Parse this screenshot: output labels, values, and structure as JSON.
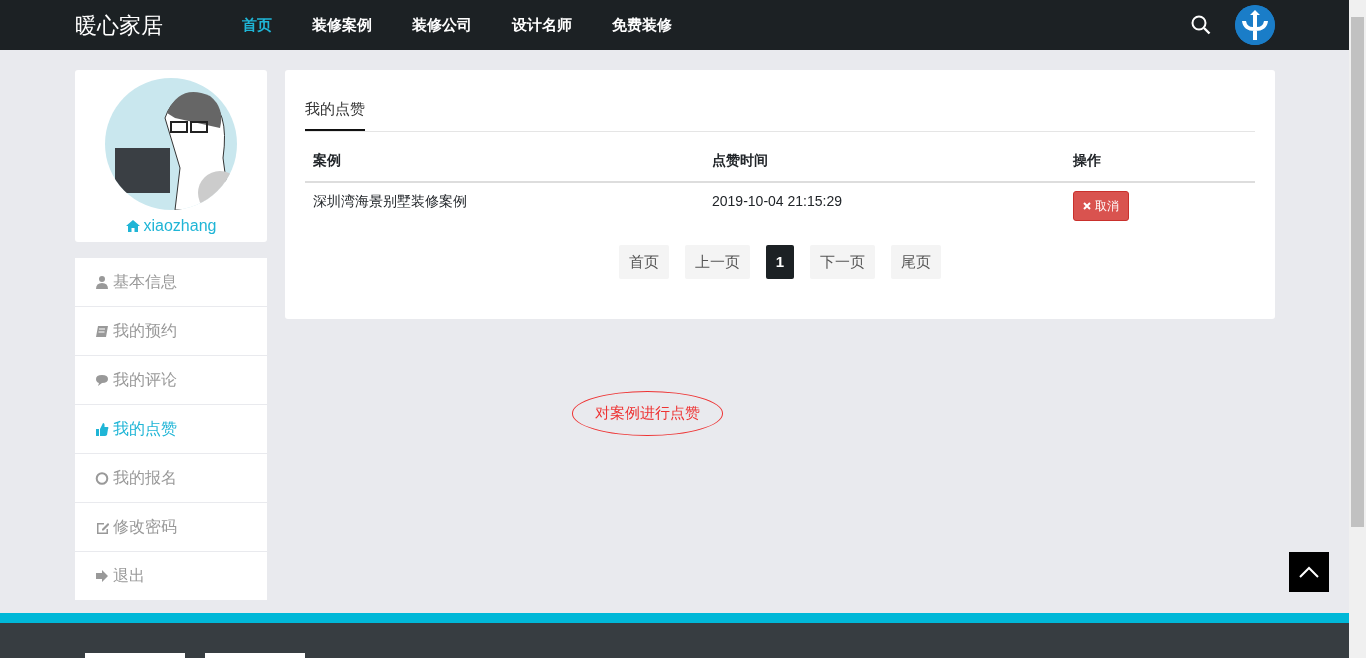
{
  "navbar": {
    "brand": "暖心家居",
    "items": [
      {
        "label": "首页",
        "selected": true
      },
      {
        "label": "装修案例",
        "selected": false
      },
      {
        "label": "装修公司",
        "selected": false
      },
      {
        "label": "设计名师",
        "selected": false
      },
      {
        "label": "免费装修",
        "selected": false
      }
    ]
  },
  "profile": {
    "username": "xiaozhang"
  },
  "sidebar": {
    "items": [
      {
        "label": "基本信息",
        "selected": false
      },
      {
        "label": "我的预约",
        "selected": false
      },
      {
        "label": "我的评论",
        "selected": false
      },
      {
        "label": "我的点赞",
        "selected": true
      },
      {
        "label": "我的报名",
        "selected": false
      },
      {
        "label": "修改密码",
        "selected": false
      },
      {
        "label": "退出",
        "selected": false
      }
    ]
  },
  "tabs": [
    {
      "label": "我的点赞",
      "selected": true
    }
  ],
  "table": {
    "columns": [
      "案例",
      "点赞时间",
      "操作"
    ],
    "rows": [
      {
        "case": "深圳湾海景别墅装修案例",
        "time": "2019-10-04 21:15:29",
        "action": "取消"
      }
    ]
  },
  "pagination": [
    {
      "label": "首页",
      "selected": false
    },
    {
      "label": "上一页",
      "selected": false
    },
    {
      "label": "1",
      "selected": true
    },
    {
      "label": "下一页",
      "selected": false
    },
    {
      "label": "尾页",
      "selected": false
    }
  ],
  "annotation": "对案例进行点赞"
}
